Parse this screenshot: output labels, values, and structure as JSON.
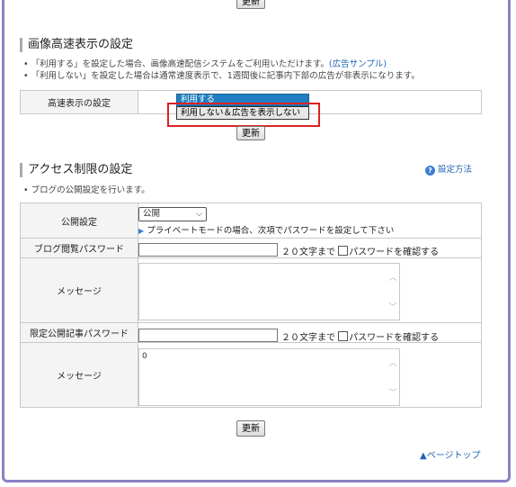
{
  "update_label": "更新",
  "speed": {
    "title": "画像高速表示の設定",
    "note1_prefix": "「利用する」を設定した場合、画像高速配信システムをご利用いただけます。",
    "note1_link": "(広告サンプル)",
    "note2": "「利用しない」を設定した場合は通常速度表示で、1週間後に記事内下部の広告が非表示になります。",
    "row_label": "高速表示の設定",
    "selected": "利用する",
    "option_highlight": "利用しない＆広告を表示しない"
  },
  "access": {
    "title": "アクセス制限の設定",
    "help_label": "設定方法",
    "note": "ブログの公開設定を行います。",
    "publish_label": "公開設定",
    "publish_value": "公開",
    "private_hint": "プライベートモードの場合、次項でパスワードを設定して下さい",
    "blog_pw_label": "ブログ閲覧パスワード",
    "limit_text": "２０文字まで",
    "confirm_label": "パスワードを確認する",
    "message_label": "メッセージ",
    "message2_value": "0",
    "limited_pw_label": "限定公開記事パスワード"
  },
  "page_top": "▲ページトップ",
  "colors": {
    "frame": "#8883c6",
    "highlight": "#dd2222",
    "select_blue": "#1f7fc2",
    "link": "#1e64b4"
  }
}
